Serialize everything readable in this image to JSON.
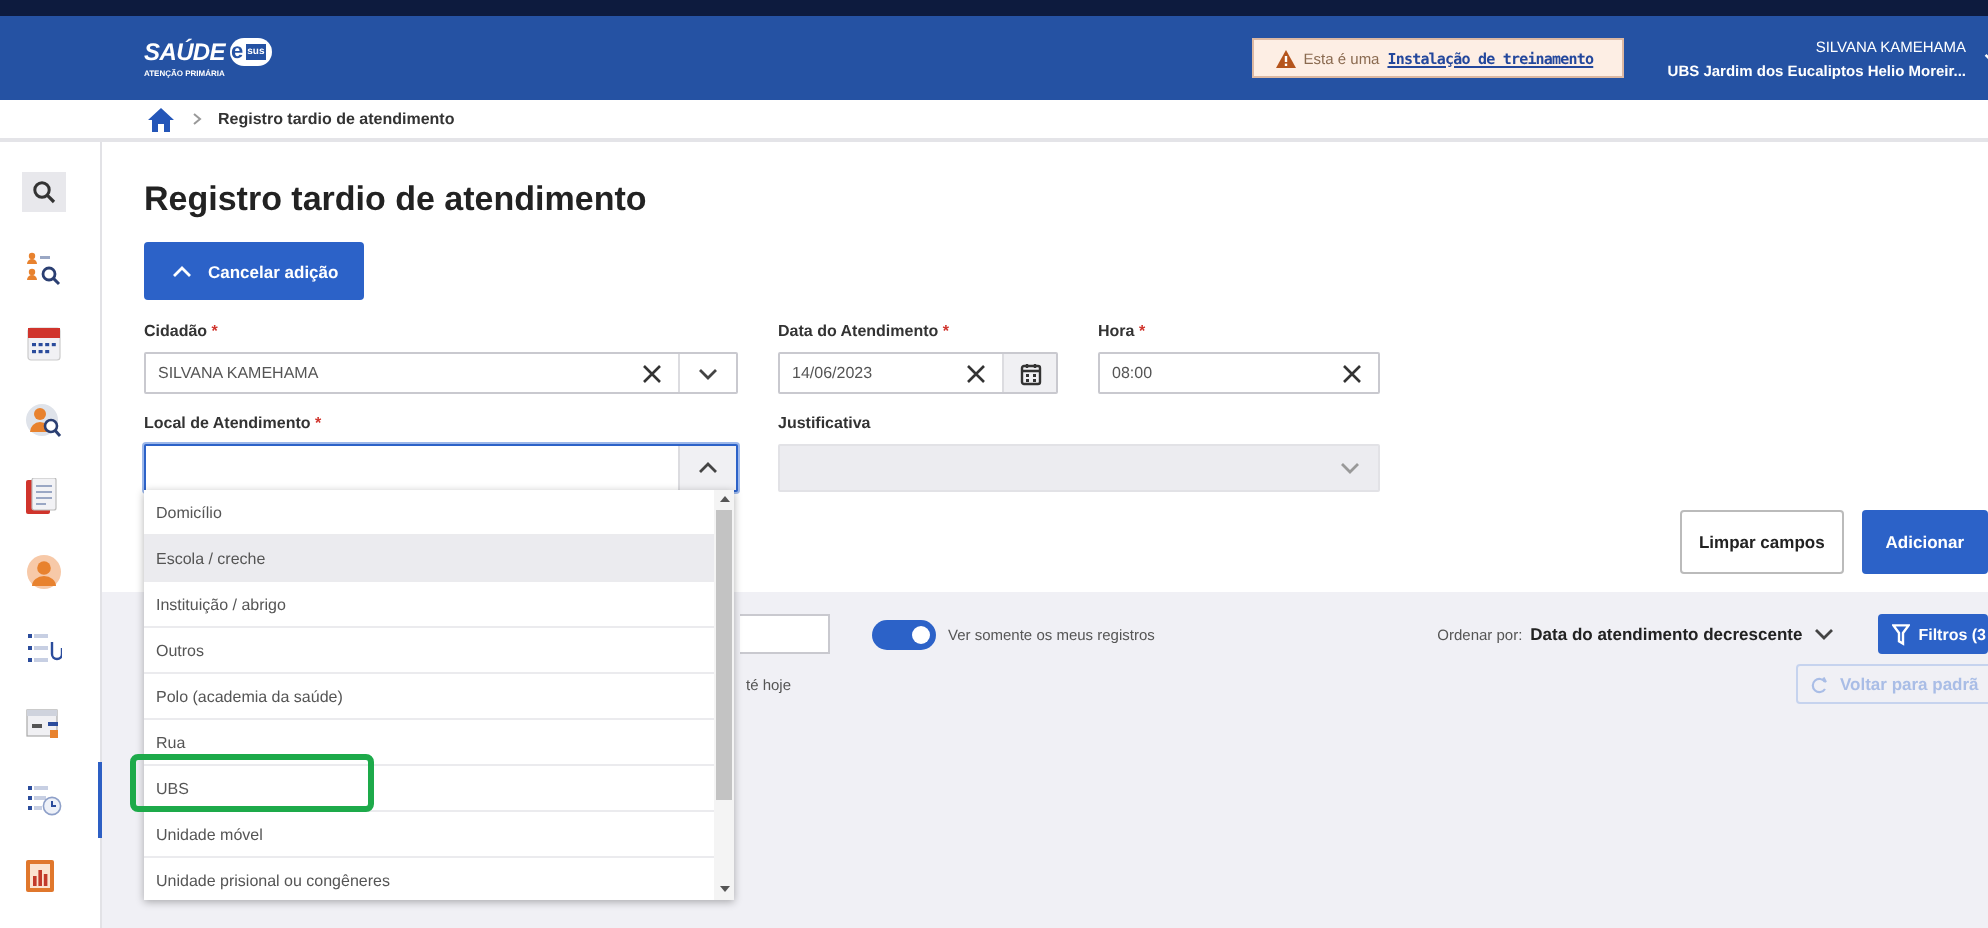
{
  "header": {
    "logo_title": "SAÚDE",
    "logo_mark": "e",
    "logo_badge": "sus",
    "logo_subtitle": "ATENÇÃO PRIMÁRIA",
    "notice_prefix": "Esta é uma",
    "notice_link": "Instalação de treinamento",
    "user_name": "SILVANA KAMEHAMA",
    "unit": "UBS Jardim dos Eucaliptos Helio Moreir..."
  },
  "breadcrumb": {
    "current": "Registro tardio de atendimento"
  },
  "sidebar": {
    "items": [
      {
        "kind": "search",
        "selected": false
      },
      {
        "kind": "people-search",
        "selected": false
      },
      {
        "kind": "calendar",
        "selected": false
      },
      {
        "kind": "person-search",
        "selected": false
      },
      {
        "kind": "document",
        "selected": false
      },
      {
        "kind": "person",
        "selected": false
      },
      {
        "kind": "list-stethoscope",
        "selected": false
      },
      {
        "kind": "window-list",
        "selected": false
      },
      {
        "kind": "list-clock",
        "selected": true
      },
      {
        "kind": "chart",
        "selected": false
      }
    ]
  },
  "title": "Registro tardio de atendimento",
  "cancel_button": "Cancelar adição",
  "required_mark": "*",
  "fields": [
    {
      "kind": "combo",
      "label": "Cidadão",
      "required": true,
      "value": "SILVANA KAMEHAMA"
    },
    {
      "kind": "date",
      "label": "Data do Atendimento",
      "required": true,
      "value": "14/06/2023"
    },
    {
      "kind": "text",
      "label": "Hora",
      "required": true,
      "value": "08:00"
    },
    {
      "kind": "select",
      "label": "Local de Atendimento",
      "required": true,
      "focused": true,
      "expanded": true,
      "disabled": false
    },
    {
      "kind": "select",
      "label": "Justificativa",
      "required": false,
      "focused": false,
      "expanded": false,
      "disabled": true
    }
  ],
  "options": [
    {
      "label": "Domicílio",
      "highlighted": false,
      "annotated": false
    },
    {
      "label": "Escola / creche",
      "highlighted": true,
      "annotated": false
    },
    {
      "label": "Instituição / abrigo",
      "highlighted": false,
      "annotated": false
    },
    {
      "label": "Outros",
      "highlighted": false,
      "annotated": false
    },
    {
      "label": "Polo (academia da saúde)",
      "highlighted": false,
      "annotated": false
    },
    {
      "label": "Rua",
      "highlighted": false,
      "annotated": false
    },
    {
      "label": "UBS",
      "highlighted": false,
      "annotated": true
    },
    {
      "label": "Unidade móvel",
      "highlighted": false,
      "annotated": false
    },
    {
      "label": "Unidade prisional ou congêneres",
      "highlighted": false,
      "annotated": false
    }
  ],
  "actions": [
    {
      "kind": "outline",
      "label": "Limpar campos"
    },
    {
      "kind": "primary",
      "label": "Adicionar"
    }
  ],
  "list": {
    "toggle": {
      "label": "Ver somente os meus registros",
      "on": true
    },
    "sort_label": "Ordenar por:",
    "sort_value": "Data do atendimento decrescente",
    "filters_button": "Filtros (3",
    "period_text": "té hoje",
    "reset_button": {
      "label": "Voltar para padrã",
      "disabled": true
    }
  }
}
